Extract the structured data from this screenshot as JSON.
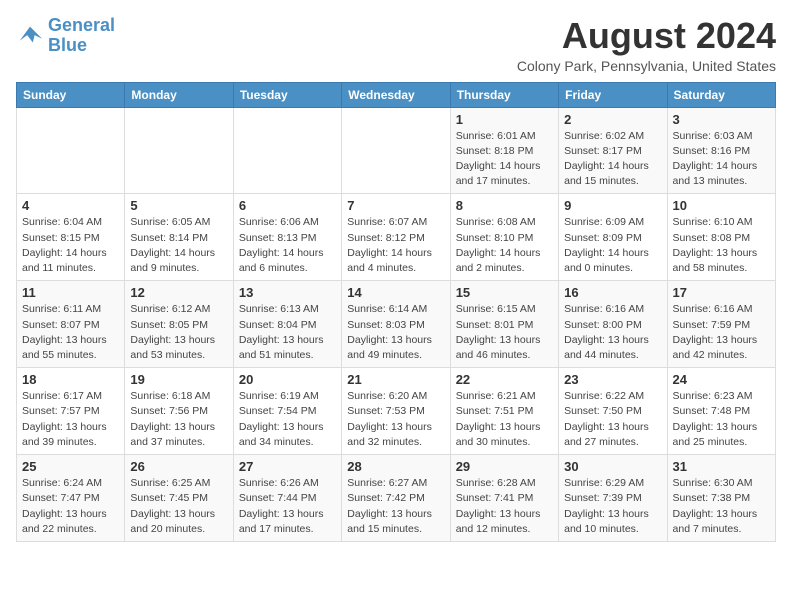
{
  "header": {
    "logo_line1": "General",
    "logo_line2": "Blue",
    "main_title": "August 2024",
    "subtitle": "Colony Park, Pennsylvania, United States"
  },
  "weekdays": [
    "Sunday",
    "Monday",
    "Tuesday",
    "Wednesday",
    "Thursday",
    "Friday",
    "Saturday"
  ],
  "weeks": [
    [
      {
        "day": "",
        "info": ""
      },
      {
        "day": "",
        "info": ""
      },
      {
        "day": "",
        "info": ""
      },
      {
        "day": "",
        "info": ""
      },
      {
        "day": "1",
        "info": "Sunrise: 6:01 AM\nSunset: 8:18 PM\nDaylight: 14 hours\nand 17 minutes."
      },
      {
        "day": "2",
        "info": "Sunrise: 6:02 AM\nSunset: 8:17 PM\nDaylight: 14 hours\nand 15 minutes."
      },
      {
        "day": "3",
        "info": "Sunrise: 6:03 AM\nSunset: 8:16 PM\nDaylight: 14 hours\nand 13 minutes."
      }
    ],
    [
      {
        "day": "4",
        "info": "Sunrise: 6:04 AM\nSunset: 8:15 PM\nDaylight: 14 hours\nand 11 minutes."
      },
      {
        "day": "5",
        "info": "Sunrise: 6:05 AM\nSunset: 8:14 PM\nDaylight: 14 hours\nand 9 minutes."
      },
      {
        "day": "6",
        "info": "Sunrise: 6:06 AM\nSunset: 8:13 PM\nDaylight: 14 hours\nand 6 minutes."
      },
      {
        "day": "7",
        "info": "Sunrise: 6:07 AM\nSunset: 8:12 PM\nDaylight: 14 hours\nand 4 minutes."
      },
      {
        "day": "8",
        "info": "Sunrise: 6:08 AM\nSunset: 8:10 PM\nDaylight: 14 hours\nand 2 minutes."
      },
      {
        "day": "9",
        "info": "Sunrise: 6:09 AM\nSunset: 8:09 PM\nDaylight: 14 hours\nand 0 minutes."
      },
      {
        "day": "10",
        "info": "Sunrise: 6:10 AM\nSunset: 8:08 PM\nDaylight: 13 hours\nand 58 minutes."
      }
    ],
    [
      {
        "day": "11",
        "info": "Sunrise: 6:11 AM\nSunset: 8:07 PM\nDaylight: 13 hours\nand 55 minutes."
      },
      {
        "day": "12",
        "info": "Sunrise: 6:12 AM\nSunset: 8:05 PM\nDaylight: 13 hours\nand 53 minutes."
      },
      {
        "day": "13",
        "info": "Sunrise: 6:13 AM\nSunset: 8:04 PM\nDaylight: 13 hours\nand 51 minutes."
      },
      {
        "day": "14",
        "info": "Sunrise: 6:14 AM\nSunset: 8:03 PM\nDaylight: 13 hours\nand 49 minutes."
      },
      {
        "day": "15",
        "info": "Sunrise: 6:15 AM\nSunset: 8:01 PM\nDaylight: 13 hours\nand 46 minutes."
      },
      {
        "day": "16",
        "info": "Sunrise: 6:16 AM\nSunset: 8:00 PM\nDaylight: 13 hours\nand 44 minutes."
      },
      {
        "day": "17",
        "info": "Sunrise: 6:16 AM\nSunset: 7:59 PM\nDaylight: 13 hours\nand 42 minutes."
      }
    ],
    [
      {
        "day": "18",
        "info": "Sunrise: 6:17 AM\nSunset: 7:57 PM\nDaylight: 13 hours\nand 39 minutes."
      },
      {
        "day": "19",
        "info": "Sunrise: 6:18 AM\nSunset: 7:56 PM\nDaylight: 13 hours\nand 37 minutes."
      },
      {
        "day": "20",
        "info": "Sunrise: 6:19 AM\nSunset: 7:54 PM\nDaylight: 13 hours\nand 34 minutes."
      },
      {
        "day": "21",
        "info": "Sunrise: 6:20 AM\nSunset: 7:53 PM\nDaylight: 13 hours\nand 32 minutes."
      },
      {
        "day": "22",
        "info": "Sunrise: 6:21 AM\nSunset: 7:51 PM\nDaylight: 13 hours\nand 30 minutes."
      },
      {
        "day": "23",
        "info": "Sunrise: 6:22 AM\nSunset: 7:50 PM\nDaylight: 13 hours\nand 27 minutes."
      },
      {
        "day": "24",
        "info": "Sunrise: 6:23 AM\nSunset: 7:48 PM\nDaylight: 13 hours\nand 25 minutes."
      }
    ],
    [
      {
        "day": "25",
        "info": "Sunrise: 6:24 AM\nSunset: 7:47 PM\nDaylight: 13 hours\nand 22 minutes."
      },
      {
        "day": "26",
        "info": "Sunrise: 6:25 AM\nSunset: 7:45 PM\nDaylight: 13 hours\nand 20 minutes."
      },
      {
        "day": "27",
        "info": "Sunrise: 6:26 AM\nSunset: 7:44 PM\nDaylight: 13 hours\nand 17 minutes."
      },
      {
        "day": "28",
        "info": "Sunrise: 6:27 AM\nSunset: 7:42 PM\nDaylight: 13 hours\nand 15 minutes."
      },
      {
        "day": "29",
        "info": "Sunrise: 6:28 AM\nSunset: 7:41 PM\nDaylight: 13 hours\nand 12 minutes."
      },
      {
        "day": "30",
        "info": "Sunrise: 6:29 AM\nSunset: 7:39 PM\nDaylight: 13 hours\nand 10 minutes."
      },
      {
        "day": "31",
        "info": "Sunrise: 6:30 AM\nSunset: 7:38 PM\nDaylight: 13 hours\nand 7 minutes."
      }
    ]
  ]
}
